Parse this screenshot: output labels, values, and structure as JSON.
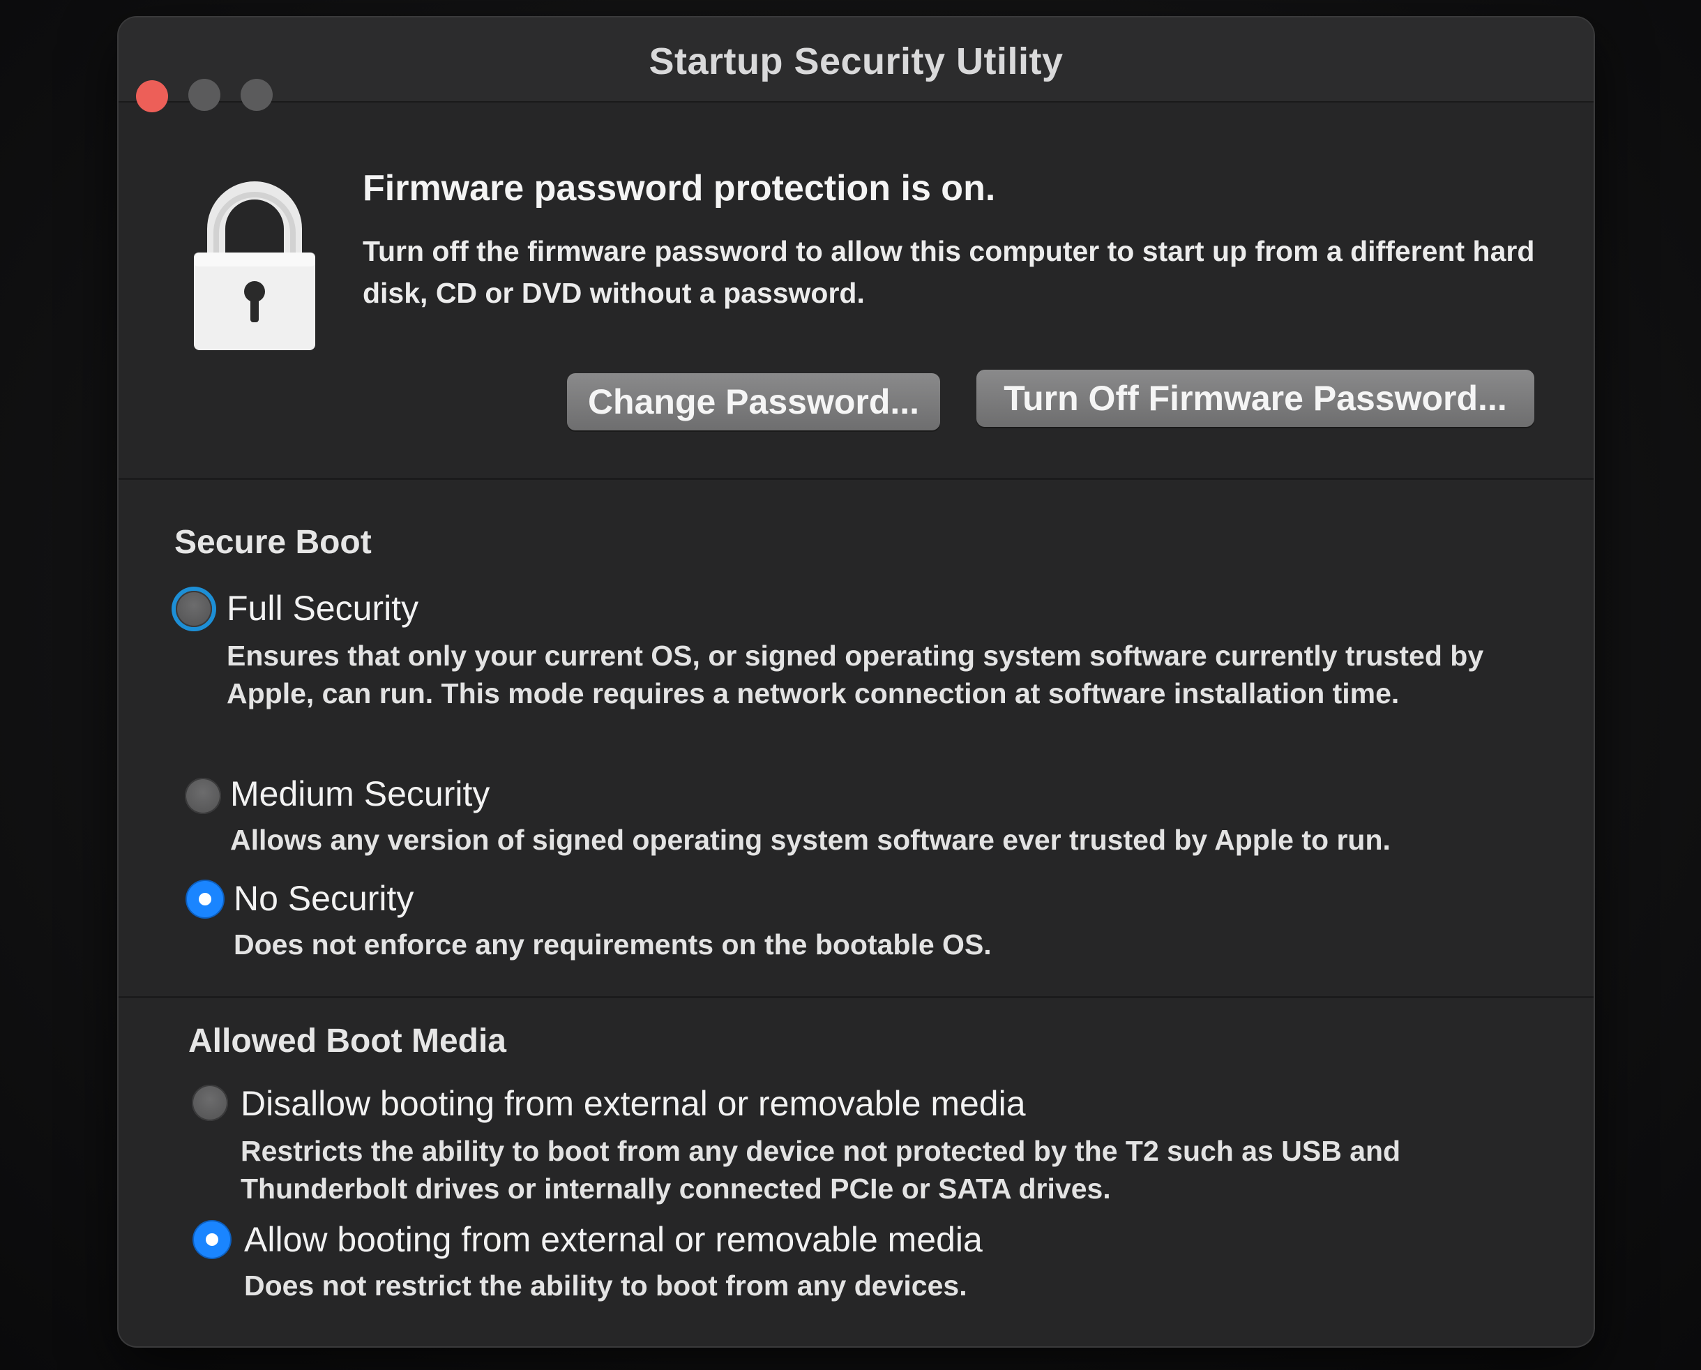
{
  "window": {
    "title": "Startup Security Utility"
  },
  "firmware": {
    "heading": "Firmware password protection is on.",
    "description": "Turn off the firmware password to allow this computer to start up from a different hard disk, CD or DVD without a password.",
    "change_button": "Change Password...",
    "turn_off_button": "Turn Off Firmware Password..."
  },
  "secure_boot": {
    "title": "Secure Boot",
    "options": [
      {
        "label": "Full Security",
        "description": "Ensures that only your current OS, or signed operating system software currently trusted by Apple, can run. This mode requires a network connection at software installation time.",
        "selected": false
      },
      {
        "label": "Medium Security",
        "description": "Allows any version of signed operating system software ever trusted by Apple to run.",
        "selected": false
      },
      {
        "label": "No Security",
        "description": "Does not enforce any requirements on the bootable OS.",
        "selected": true
      }
    ]
  },
  "boot_media": {
    "title": "Allowed Boot Media",
    "options": [
      {
        "label": "Disallow booting from external or removable media",
        "description": "Restricts the ability to boot from any device not protected by the T2 such as USB and Thunderbolt drives or internally connected PCIe or SATA drives.",
        "selected": false
      },
      {
        "label": "Allow booting from external or removable media",
        "description": "Does not restrict the ability to boot from any devices.",
        "selected": true
      }
    ]
  },
  "colors": {
    "accent": "#1a85ff",
    "window_bg": "#262627",
    "close_button": "#ed5f58"
  },
  "icons": [
    "lock-icon"
  ]
}
